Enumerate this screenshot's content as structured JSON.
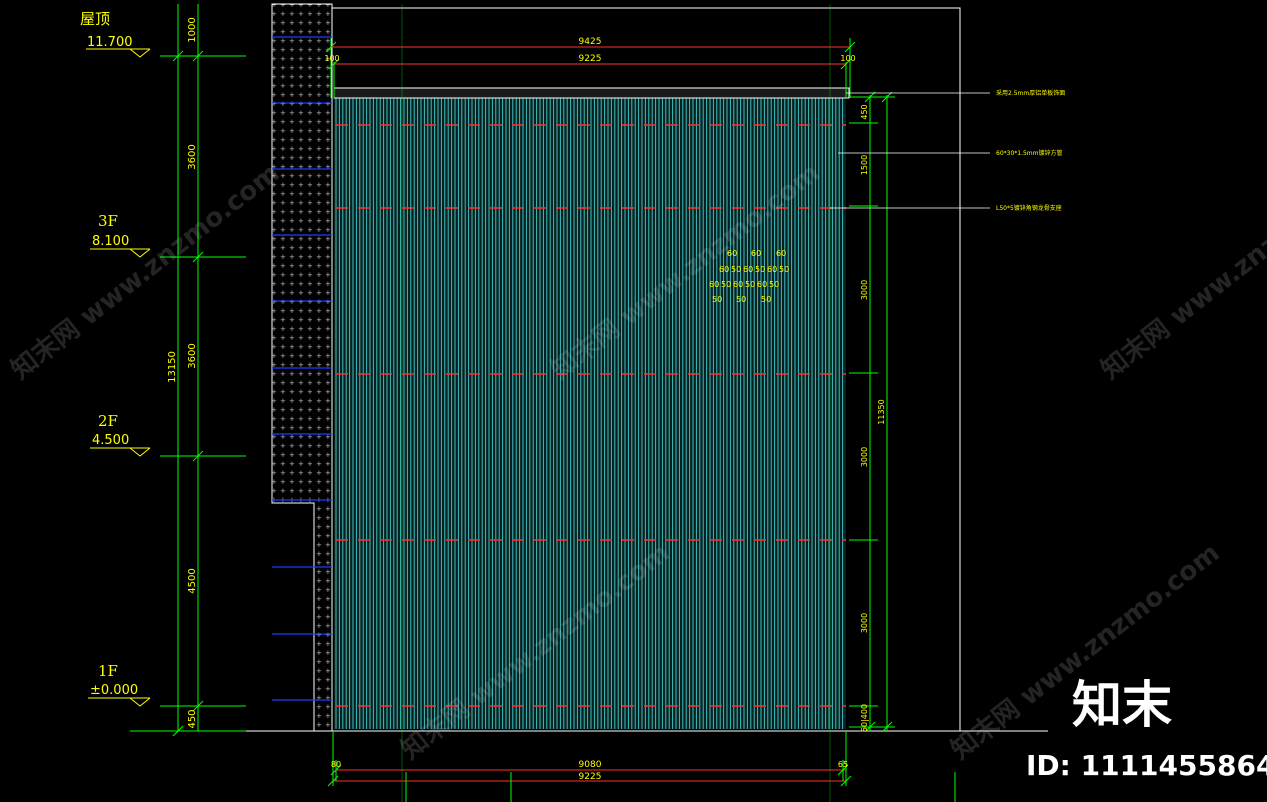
{
  "levels": [
    {
      "name": "屋顶",
      "value": "11.700"
    },
    {
      "name": "3F",
      "value": "8.100"
    },
    {
      "name": "2F",
      "value": "4.500"
    },
    {
      "name": "1F",
      "value": "±0.000"
    }
  ],
  "left_dims": {
    "floor_heights": [
      "1000",
      "3600",
      "3600",
      "4500",
      "450"
    ],
    "total": "13150"
  },
  "top_dims": {
    "overall": "9425",
    "inner": "9225",
    "left_offset": "100",
    "right_offset": "100"
  },
  "bottom_dims": {
    "inner": "9080",
    "overall": "9225",
    "left_offset": "80",
    "right_offset": "65"
  },
  "right_dims": {
    "segments": [
      "450",
      "1500",
      "3000",
      "3000",
      "3000"
    ],
    "total": "11350",
    "bottom_pair": "50|400"
  },
  "fin_spacing_labels": {
    "row1": [
      "60",
      "60",
      "60"
    ],
    "row2": [
      "60",
      "50",
      "60",
      "50",
      "60",
      "50"
    ],
    "row3": [
      "60",
      "50",
      "60",
      "50",
      "60",
      "50"
    ],
    "row4": [
      "50",
      "50",
      "50"
    ]
  },
  "annotations": [
    "采用2.5mm厚铝单板饰面",
    "60*30*1.5mm镀锌方管",
    "L50*5镀锌角钢龙骨支座"
  ],
  "watermark": {
    "text": "知末网 www.znzmo.com"
  },
  "brand": {
    "name": "知末",
    "id": "ID: 1111455864"
  },
  "colors": {
    "background": "#000000",
    "level_text": "#ffff00",
    "dim_line": "#00ff00",
    "fin": "#3fbfbf",
    "keel": "#ff3030",
    "wall_border": "#ffffff",
    "floor_mark": "#1a3cff"
  }
}
